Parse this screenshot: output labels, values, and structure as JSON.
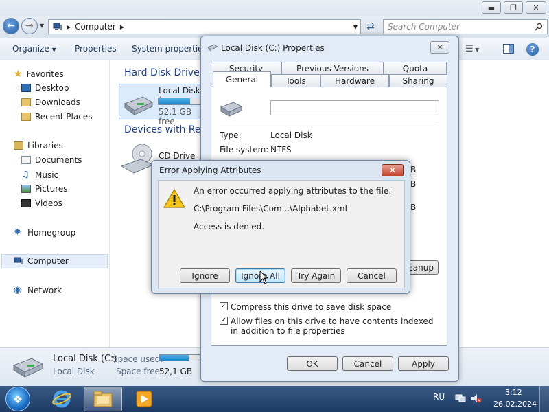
{
  "explorer": {
    "address": {
      "crumb": "Computer",
      "search_placeholder": "Search Computer"
    },
    "toolbar": {
      "organize": "Organize",
      "properties": "Properties",
      "system_properties": "System properties"
    },
    "sidebar": {
      "favorites": "Favorites",
      "favorites_items": [
        "Desktop",
        "Downloads",
        "Recent Places"
      ],
      "libraries": "Libraries",
      "libraries_items": [
        "Documents",
        "Music",
        "Pictures",
        "Videos"
      ],
      "homegroup": "Homegroup",
      "computer": "Computer",
      "network": "Network"
    },
    "main": {
      "group_hard_disks": "Hard Disk Drives",
      "local_disk_label": "Local Disk (",
      "local_disk_free": "52,1 GB free",
      "local_disk_used_fraction": 0.72,
      "group_devices": "Devices with Rem",
      "cd_drive_label": "CD Drive (D"
    },
    "details": {
      "name": "Local Disk (C:)",
      "type": "Local Disk",
      "space_used_label": "Space used:",
      "space_free_label": "Space free:",
      "space_free_value": "52,1 GB",
      "space_used_fraction": 0.72
    }
  },
  "properties_dialog": {
    "title": "Local Disk (C:) Properties",
    "tabs_row1": [
      "Security",
      "Previous Versions",
      "Quota"
    ],
    "tabs_row2": [
      "General",
      "Tools",
      "Hardware",
      "Sharing"
    ],
    "active_tab": "General",
    "name_value": "",
    "type_label": "Type:",
    "type_value": "Local Disk",
    "fs_label": "File system:",
    "fs_value": "NTFS",
    "right_fragments": [
      "B",
      "B",
      "B"
    ],
    "cleanup_fragment": "leanup",
    "compress_label": "Compress this drive to save disk space",
    "index_label": "Allow files on this drive to have contents indexed in addition to file properties",
    "buttons": {
      "ok": "OK",
      "cancel": "Cancel",
      "apply": "Apply"
    }
  },
  "error_dialog": {
    "title": "Error Applying Attributes",
    "message": "An error occurred applying attributes to the file:",
    "path": "C:\\Program Files\\Com...\\Alphabet.xml",
    "detail": "Access is denied.",
    "buttons": {
      "ignore": "Ignore",
      "ignore_all": "Ignore All",
      "try_again": "Try Again",
      "cancel": "Cancel"
    }
  },
  "taskbar": {
    "language": "RU",
    "time": "3:12",
    "date": "26.02.2024"
  }
}
